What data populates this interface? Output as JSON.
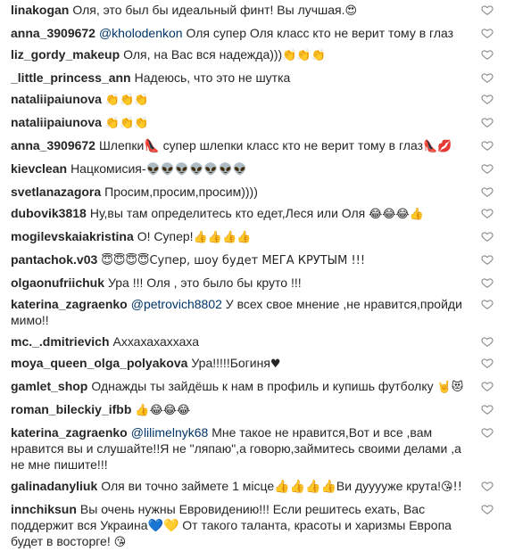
{
  "icons": {
    "like": "heart-outline-icon"
  },
  "colors": {
    "username": "#262626",
    "mention": "#003569",
    "icon": "#8e8e8e"
  },
  "comments": [
    {
      "user": "linakogan",
      "mention": "",
      "text": "Оля, это был бы идеальный финт! Вы лучшая.",
      "emoji": " 😍"
    },
    {
      "user": "anna_3909672",
      "mention": "@kholodenkon",
      "text": " Оля супер Оля класс кто не верит тому в глаз",
      "emoji": ""
    },
    {
      "user": "liz_gordy_makeup",
      "mention": "",
      "text": "Оля, на Вас вся надежда)))",
      "emoji": "👏👏👏"
    },
    {
      "user": "_little_princess_ann",
      "mention": "",
      "text": "Надеюсь, что это не шутка",
      "emoji": ""
    },
    {
      "user": "nataliipaiunova",
      "mention": "",
      "text": "",
      "emoji": "👏👏👏"
    },
    {
      "user": "nataliipaiunova",
      "mention": "",
      "text": "",
      "emoji": "👏👏👏"
    },
    {
      "user": "anna_3909672",
      "mention": "",
      "text": "Шлепки👠 супер шлепки класс кто не верит тому в глаз",
      "emoji": "👠💋"
    },
    {
      "user": "kievclean",
      "mention": "",
      "text": "Нацкомисия-",
      "emoji": "👽👽👽👽👽👽👽"
    },
    {
      "user": "svetlanazagora",
      "mention": "",
      "text": "Просим,просим,просим))))",
      "emoji": ""
    },
    {
      "user": "dubovik3818",
      "mention": "",
      "text": "Ну,вы там определитесь кто едет,Леся или Оля ",
      "emoji": "😂😂😂👍"
    },
    {
      "user": "mogilevskaiakristina",
      "mention": "",
      "text": "О! Супер!",
      "emoji": "👍👍👍👍"
    },
    {
      "user": "pantachok.v03",
      "mention": "",
      "text": "",
      "emoji": "😇😇😇😇Супер, шоу будет МЕГА КРУТЫМ !!!"
    },
    {
      "user": "olgaonufriichuk",
      "mention": "",
      "text": "Ура !!! Оля , это было бы круто !!!",
      "emoji": ""
    },
    {
      "user": "katerina_zagraenko",
      "mention": "@petrovich8802",
      "text": " У всех свое мнение ,не нравится,пройди мимо!!",
      "emoji": ""
    },
    {
      "user": "mc._.dmitrievich",
      "mention": "",
      "text": "Аххахахаххаха",
      "emoji": ""
    },
    {
      "user": "moya_queen_olga_polyakova",
      "mention": "",
      "text": "Ура!!!!!Богиня",
      "emoji": "♥"
    },
    {
      "user": "gamlet_shop",
      "mention": "",
      "text": "Однажды ты зайдёшь к нам в профиль и купишь футболку ",
      "emoji": "🤘😻"
    },
    {
      "user": "roman_bileckiy_ifbb",
      "mention": "",
      "text": "",
      "emoji": "👍😂😂😂"
    },
    {
      "user": "katerina_zagraenko",
      "mention": "@lilimelnyk68",
      "text": " Мне такое не нравится,Вот и все ,вам нравится вы и слушайте!!Я не \"ляпаю\",а говорю,займитесь своими делами ,а не мне пишите!!!",
      "emoji": ""
    },
    {
      "user": "galinadanyliuk",
      "mention": "",
      "text": "Оля ви точно займете 1 місце👍👍👍👍Ви дууууже крута!",
      "emoji": "😘!!"
    },
    {
      "user": "innchiksun",
      "mention": "",
      "text": "Вы очень нужны Евровидению!!! Если решитесь ехать, Вас поддержит вся Украина💙💛 От такого таланта, красоты и харизмы Европа будет в восторге! ",
      "emoji": "😘"
    }
  ]
}
